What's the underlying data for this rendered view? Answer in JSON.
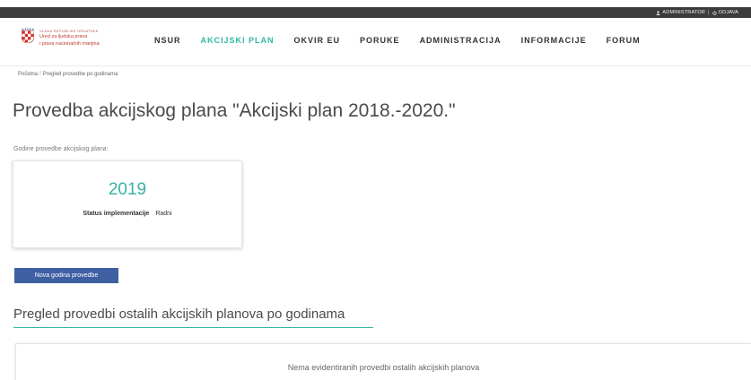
{
  "topbar": {
    "user_label": "ADMINISTRATOR",
    "separator": "|",
    "logout_label": "ODJAVA"
  },
  "logo": {
    "gov_line": "VLADA REPUBLIKE HRVATSKE",
    "office_line_1": "Ured za ljudska prava",
    "office_line_2": "i prava nacionalnih manjina"
  },
  "nav": {
    "items": [
      {
        "label": "NSUR",
        "active": false
      },
      {
        "label": "AKCIJSKI PLAN",
        "active": true
      },
      {
        "label": "OKVIR EU",
        "active": false
      },
      {
        "label": "PORUKE",
        "active": false
      },
      {
        "label": "ADMINISTRACIJA",
        "active": false
      },
      {
        "label": "INFORMACIJE",
        "active": false
      },
      {
        "label": "FORUM",
        "active": false
      }
    ]
  },
  "breadcrumb": {
    "home": "Početna",
    "separator": "/",
    "current": "Pregled provedbe po godinama"
  },
  "page_title": "Provedba akcijskog plana \"Akcijski plan 2018.-2020.\"",
  "years": {
    "label": "Godine provedbe akcijskog plana:",
    "cards": [
      {
        "year": "2019",
        "status_label": "Status implementacije",
        "status_value": "Radni"
      }
    ]
  },
  "new_year_button": "Nova godina provedbe",
  "other_plans": {
    "heading": "Pregled provedbi ostalih akcijskih planova po godinama",
    "empty_message": "Nema evidentiranih provedbi ostalih akcijskih planova"
  },
  "colors": {
    "accent": "#34b5a7",
    "button": "#3f5fa3",
    "topbar": "#3c3c3c"
  }
}
